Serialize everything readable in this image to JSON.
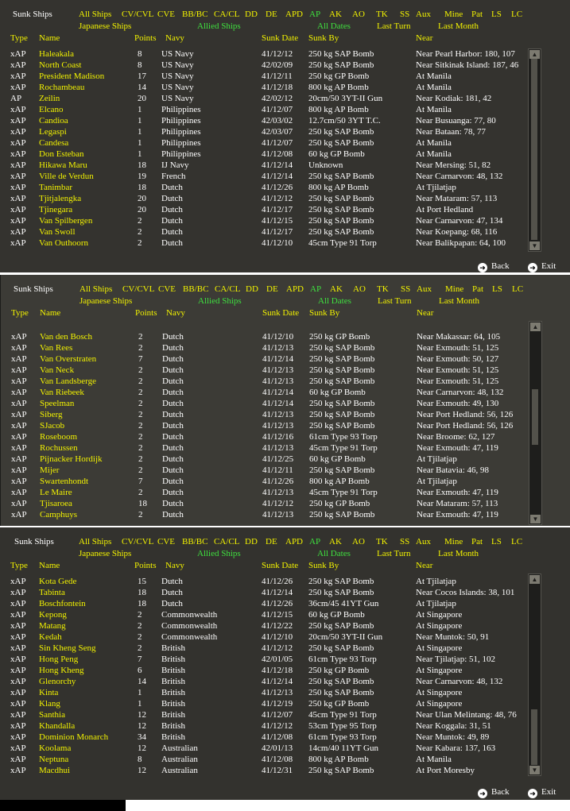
{
  "ui": {
    "title": "Sunk Ships",
    "filters": [
      "All Ships",
      "CV/CVL",
      "CVE",
      "BB/BC",
      "CA/CL",
      "DD",
      "DE",
      "APD",
      "AP",
      "AK",
      "AO",
      "TK",
      "SS",
      "Aux",
      "Mine",
      "Pat",
      "LS",
      "LC"
    ],
    "selected_filter": "AP",
    "side_filter": {
      "japanese": "Japanese Ships",
      "allied": "Allied Ships"
    },
    "date_filter": {
      "all": "All Dates",
      "last_turn": "Last Turn",
      "last_month": "Last Month"
    },
    "columns": {
      "type": "Type",
      "name": "Name",
      "points": "Points",
      "navy": "Navy",
      "date": "Sunk Date",
      "by": "Sunk By",
      "near": "Near"
    },
    "back": "Back",
    "exit": "Exit",
    "colors": {
      "highlight": "#3fe03f",
      "label": "#f2f200",
      "text": "#ffffff",
      "panel": "#3a3a35"
    }
  },
  "panels": [
    {
      "rows": [
        [
          "xAP",
          "Haleakala",
          "8",
          "US Navy",
          "41/12/12",
          "250 kg SAP Bomb",
          "Near Pearl Harbor: 180, 107"
        ],
        [
          "xAP",
          "North Coast",
          "8",
          "US Navy",
          "42/02/09",
          "250 kg SAP Bomb",
          "Near Sitkinak Island: 187, 46"
        ],
        [
          "xAP",
          "President Madison",
          "17",
          "US Navy",
          "41/12/11",
          "250 kg GP Bomb",
          "At Manila"
        ],
        [
          "xAP",
          "Rochambeau",
          "14",
          "US Navy",
          "41/12/18",
          "800 kg AP Bomb",
          "At Manila"
        ],
        [
          "AP",
          "Zeilin",
          "20",
          "US Navy",
          "42/02/12",
          "20cm/50 3YT-II Gun",
          "Near Kodiak: 181, 42"
        ],
        [
          "xAP",
          "Elcano",
          "1",
          "Philippines",
          "41/12/07",
          "800 kg AP Bomb",
          "At Manila"
        ],
        [
          "xAP",
          "Candioa",
          "1",
          "Philippines",
          "42/03/02",
          "12.7cm/50 3YT T.C.",
          "Near Busuanga: 77, 80"
        ],
        [
          "xAP",
          "Legaspi",
          "1",
          "Philippines",
          "42/03/07",
          "250 kg SAP Bomb",
          "Near Bataan: 78, 77"
        ],
        [
          "xAP",
          "Candesa",
          "1",
          "Philippines",
          "41/12/07",
          "250 kg SAP Bomb",
          "At Manila"
        ],
        [
          "xAP",
          "Don Esteban",
          "1",
          "Philippines",
          "41/12/08",
          "60 kg GP Bomb",
          "At Manila"
        ],
        [
          "xAP",
          "Hikawa Maru",
          "18",
          "IJ Navy",
          "41/12/14",
          "Unknown",
          "Near Mersing: 51, 82"
        ],
        [
          "xAP",
          "Ville de Verdun",
          "19",
          "French",
          "41/12/14",
          "250 kg SAP Bomb",
          "Near Carnarvon: 48, 132"
        ],
        [
          "xAP",
          "Tanimbar",
          "18",
          "Dutch",
          "41/12/26",
          "800 kg AP Bomb",
          "At Tjilatjap"
        ],
        [
          "xAP",
          "Tjitjalengka",
          "20",
          "Dutch",
          "41/12/12",
          "250 kg SAP Bomb",
          "Near Mataram: 57, 113"
        ],
        [
          "xAP",
          "Tjinegara",
          "20",
          "Dutch",
          "41/12/17",
          "250 kg SAP Bomb",
          "At Port Hedland"
        ],
        [
          "xAP",
          "Van Spilbergen",
          "2",
          "Dutch",
          "41/12/15",
          "250 kg SAP Bomb",
          "Near Carnarvon: 47, 134"
        ],
        [
          "xAP",
          "Van Swoll",
          "2",
          "Dutch",
          "41/12/17",
          "250 kg SAP Bomb",
          "Near Koepang: 68, 116"
        ],
        [
          "xAP",
          "Van Outhoorn",
          "2",
          "Dutch",
          "41/12/10",
          "45cm Type 91 Torp",
          "Near Balikpapan: 64, 100"
        ]
      ]
    },
    {
      "rows": [
        [
          "xAP",
          "Van den Bosch",
          "2",
          "Dutch",
          "41/12/10",
          "250 kg GP Bomb",
          "Near Makassar: 64, 105"
        ],
        [
          "xAP",
          "Van Rees",
          "2",
          "Dutch",
          "41/12/13",
          "250 kg SAP Bomb",
          "Near Exmouth: 51, 125"
        ],
        [
          "xAP",
          "Van Overstraten",
          "7",
          "Dutch",
          "41/12/14",
          "250 kg SAP Bomb",
          "Near Exmouth: 50, 127"
        ],
        [
          "xAP",
          "Van Neck",
          "2",
          "Dutch",
          "41/12/13",
          "250 kg SAP Bomb",
          "Near Exmouth: 51, 125"
        ],
        [
          "xAP",
          "Van Landsberge",
          "2",
          "Dutch",
          "41/12/13",
          "250 kg SAP Bomb",
          "Near Exmouth: 51, 125"
        ],
        [
          "xAP",
          "Van Riebeek",
          "2",
          "Dutch",
          "41/12/14",
          "60 kg GP Bomb",
          "Near Carnarvon: 48, 132"
        ],
        [
          "xAP",
          "Speelman",
          "2",
          "Dutch",
          "41/12/14",
          "250 kg SAP Bomb",
          "Near Exmouth: 49, 130"
        ],
        [
          "xAP",
          "Siberg",
          "2",
          "Dutch",
          "41/12/13",
          "250 kg SAP Bomb",
          "Near Port Hedland: 56, 126"
        ],
        [
          "xAP",
          "SJacob",
          "2",
          "Dutch",
          "41/12/13",
          "250 kg SAP Bomb",
          "Near Port Hedland: 56, 126"
        ],
        [
          "xAP",
          "Roseboom",
          "2",
          "Dutch",
          "41/12/16",
          "61cm Type 93 Torp",
          "Near Broome: 62, 127"
        ],
        [
          "xAP",
          "Rochussen",
          "2",
          "Dutch",
          "41/12/13",
          "45cm Type 91 Torp",
          "Near Exmouth: 47, 119"
        ],
        [
          "xAP",
          "Pijnacker Hordijk",
          "2",
          "Dutch",
          "41/12/25",
          "60 kg GP Bomb",
          "At Tjilatjap"
        ],
        [
          "xAP",
          "Mijer",
          "2",
          "Dutch",
          "41/12/11",
          "250 kg SAP Bomb",
          "Near Batavia: 46, 98"
        ],
        [
          "xAP",
          "Swartenhondt",
          "7",
          "Dutch",
          "41/12/26",
          "800 kg AP Bomb",
          "At Tjilatjap"
        ],
        [
          "xAP",
          "Le Maire",
          "2",
          "Dutch",
          "41/12/13",
          "45cm Type 91 Torp",
          "Near Exmouth: 47, 119"
        ],
        [
          "xAP",
          "Tjisaroea",
          "18",
          "Dutch",
          "41/12/12",
          "250 kg GP Bomb",
          "Near Mataram: 57, 113"
        ],
        [
          "xAP",
          "Camphuys",
          "2",
          "Dutch",
          "41/12/13",
          "250 kg SAP Bomb",
          "Near Exmouth: 47, 119"
        ]
      ]
    },
    {
      "rows": [
        [
          "xAP",
          "Kota Gede",
          "15",
          "Dutch",
          "41/12/26",
          "250 kg SAP Bomb",
          "At Tjilatjap"
        ],
        [
          "xAP",
          "Tabinta",
          "18",
          "Dutch",
          "41/12/14",
          "250 kg SAP Bomb",
          "Near Cocos Islands: 38, 101"
        ],
        [
          "xAP",
          "Boschfontein",
          "18",
          "Dutch",
          "41/12/26",
          "36cm/45 41YT Gun",
          "At Tjilatjap"
        ],
        [
          "xAP",
          "Kepong",
          "2",
          "Commonwealth",
          "41/12/15",
          "60 kg GP Bomb",
          "At Singapore"
        ],
        [
          "xAP",
          "Matang",
          "2",
          "Commonwealth",
          "41/12/22",
          "250 kg SAP Bomb",
          "At Singapore"
        ],
        [
          "xAP",
          "Kedah",
          "2",
          "Commonwealth",
          "41/12/10",
          "20cm/50 3YT-II Gun",
          "Near Muntok: 50, 91"
        ],
        [
          "xAP",
          "Sin Kheng Seng",
          "2",
          "British",
          "41/12/12",
          "250 kg SAP Bomb",
          "At Singapore"
        ],
        [
          "xAP",
          "Hong Peng",
          "7",
          "British",
          "42/01/05",
          "61cm Type 93 Torp",
          "Near Tjilatjap: 51, 102"
        ],
        [
          "xAP",
          "Hong Kheng",
          "6",
          "British",
          "41/12/18",
          "250 kg GP Bomb",
          "At Singapore"
        ],
        [
          "xAP",
          "Glenorchy",
          "14",
          "British",
          "41/12/14",
          "250 kg SAP Bomb",
          "Near Carnarvon: 48, 132"
        ],
        [
          "xAP",
          "Kinta",
          "1",
          "British",
          "41/12/13",
          "250 kg SAP Bomb",
          "At Singapore"
        ],
        [
          "xAP",
          "Klang",
          "1",
          "British",
          "41/12/19",
          "250 kg GP Bomb",
          "At Singapore"
        ],
        [
          "xAP",
          "Santhia",
          "12",
          "British",
          "41/12/07",
          "45cm Type 91 Torp",
          "Near Ulan Melintang: 48, 76"
        ],
        [
          "xAP",
          "Khandalla",
          "12",
          "British",
          "41/12/12",
          "53cm Type 95 Torp",
          "Near Koggala: 31, 51"
        ],
        [
          "xAP",
          "Dominion Monarch",
          "34",
          "British",
          "41/12/08",
          "61cm Type 93 Torp",
          "Near Muntok: 49, 89"
        ],
        [
          "xAP",
          "Koolama",
          "12",
          "Australian",
          "42/01/13",
          "14cm/40 11YT Gun",
          "Near Kabara: 137, 163"
        ],
        [
          "xAP",
          "Neptuna",
          "8",
          "Australian",
          "41/12/08",
          "800 kg AP Bomb",
          "At Manila"
        ],
        [
          "xAP",
          "Macdhui",
          "12",
          "Australian",
          "41/12/31",
          "250 kg SAP Bomb",
          "At Port Moresby"
        ]
      ]
    }
  ]
}
